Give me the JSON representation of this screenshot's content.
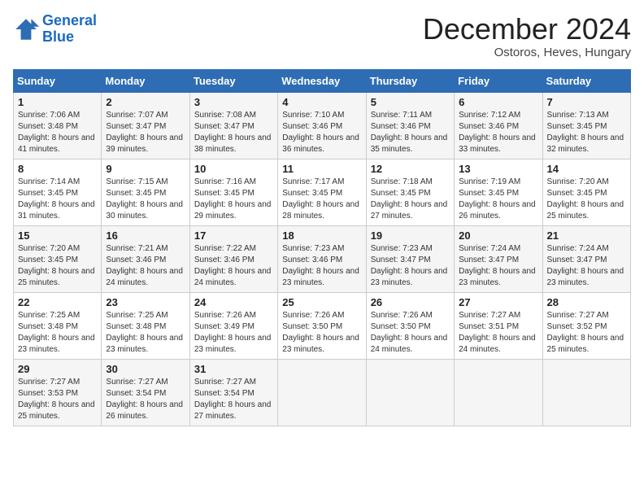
{
  "logo": {
    "line1": "General",
    "line2": "Blue"
  },
  "title": "December 2024",
  "subtitle": "Ostoros, Heves, Hungary",
  "headers": [
    "Sunday",
    "Monday",
    "Tuesday",
    "Wednesday",
    "Thursday",
    "Friday",
    "Saturday"
  ],
  "weeks": [
    [
      {
        "day": "1",
        "sunrise": "7:06 AM",
        "sunset": "3:48 PM",
        "daylight": "8 hours and 41 minutes."
      },
      {
        "day": "2",
        "sunrise": "7:07 AM",
        "sunset": "3:47 PM",
        "daylight": "8 hours and 39 minutes."
      },
      {
        "day": "3",
        "sunrise": "7:08 AM",
        "sunset": "3:47 PM",
        "daylight": "8 hours and 38 minutes."
      },
      {
        "day": "4",
        "sunrise": "7:10 AM",
        "sunset": "3:46 PM",
        "daylight": "8 hours and 36 minutes."
      },
      {
        "day": "5",
        "sunrise": "7:11 AM",
        "sunset": "3:46 PM",
        "daylight": "8 hours and 35 minutes."
      },
      {
        "day": "6",
        "sunrise": "7:12 AM",
        "sunset": "3:46 PM",
        "daylight": "8 hours and 33 minutes."
      },
      {
        "day": "7",
        "sunrise": "7:13 AM",
        "sunset": "3:45 PM",
        "daylight": "8 hours and 32 minutes."
      }
    ],
    [
      {
        "day": "8",
        "sunrise": "7:14 AM",
        "sunset": "3:45 PM",
        "daylight": "8 hours and 31 minutes."
      },
      {
        "day": "9",
        "sunrise": "7:15 AM",
        "sunset": "3:45 PM",
        "daylight": "8 hours and 30 minutes."
      },
      {
        "day": "10",
        "sunrise": "7:16 AM",
        "sunset": "3:45 PM",
        "daylight": "8 hours and 29 minutes."
      },
      {
        "day": "11",
        "sunrise": "7:17 AM",
        "sunset": "3:45 PM",
        "daylight": "8 hours and 28 minutes."
      },
      {
        "day": "12",
        "sunrise": "7:18 AM",
        "sunset": "3:45 PM",
        "daylight": "8 hours and 27 minutes."
      },
      {
        "day": "13",
        "sunrise": "7:19 AM",
        "sunset": "3:45 PM",
        "daylight": "8 hours and 26 minutes."
      },
      {
        "day": "14",
        "sunrise": "7:20 AM",
        "sunset": "3:45 PM",
        "daylight": "8 hours and 25 minutes."
      }
    ],
    [
      {
        "day": "15",
        "sunrise": "7:20 AM",
        "sunset": "3:45 PM",
        "daylight": "8 hours and 25 minutes."
      },
      {
        "day": "16",
        "sunrise": "7:21 AM",
        "sunset": "3:46 PM",
        "daylight": "8 hours and 24 minutes."
      },
      {
        "day": "17",
        "sunrise": "7:22 AM",
        "sunset": "3:46 PM",
        "daylight": "8 hours and 24 minutes."
      },
      {
        "day": "18",
        "sunrise": "7:23 AM",
        "sunset": "3:46 PM",
        "daylight": "8 hours and 23 minutes."
      },
      {
        "day": "19",
        "sunrise": "7:23 AM",
        "sunset": "3:47 PM",
        "daylight": "8 hours and 23 minutes."
      },
      {
        "day": "20",
        "sunrise": "7:24 AM",
        "sunset": "3:47 PM",
        "daylight": "8 hours and 23 minutes."
      },
      {
        "day": "21",
        "sunrise": "7:24 AM",
        "sunset": "3:47 PM",
        "daylight": "8 hours and 23 minutes."
      }
    ],
    [
      {
        "day": "22",
        "sunrise": "7:25 AM",
        "sunset": "3:48 PM",
        "daylight": "8 hours and 23 minutes."
      },
      {
        "day": "23",
        "sunrise": "7:25 AM",
        "sunset": "3:48 PM",
        "daylight": "8 hours and 23 minutes."
      },
      {
        "day": "24",
        "sunrise": "7:26 AM",
        "sunset": "3:49 PM",
        "daylight": "8 hours and 23 minutes."
      },
      {
        "day": "25",
        "sunrise": "7:26 AM",
        "sunset": "3:50 PM",
        "daylight": "8 hours and 23 minutes."
      },
      {
        "day": "26",
        "sunrise": "7:26 AM",
        "sunset": "3:50 PM",
        "daylight": "8 hours and 24 minutes."
      },
      {
        "day": "27",
        "sunrise": "7:27 AM",
        "sunset": "3:51 PM",
        "daylight": "8 hours and 24 minutes."
      },
      {
        "day": "28",
        "sunrise": "7:27 AM",
        "sunset": "3:52 PM",
        "daylight": "8 hours and 25 minutes."
      }
    ],
    [
      {
        "day": "29",
        "sunrise": "7:27 AM",
        "sunset": "3:53 PM",
        "daylight": "8 hours and 25 minutes."
      },
      {
        "day": "30",
        "sunrise": "7:27 AM",
        "sunset": "3:54 PM",
        "daylight": "8 hours and 26 minutes."
      },
      {
        "day": "31",
        "sunrise": "7:27 AM",
        "sunset": "3:54 PM",
        "daylight": "8 hours and 27 minutes."
      },
      null,
      null,
      null,
      null
    ]
  ]
}
